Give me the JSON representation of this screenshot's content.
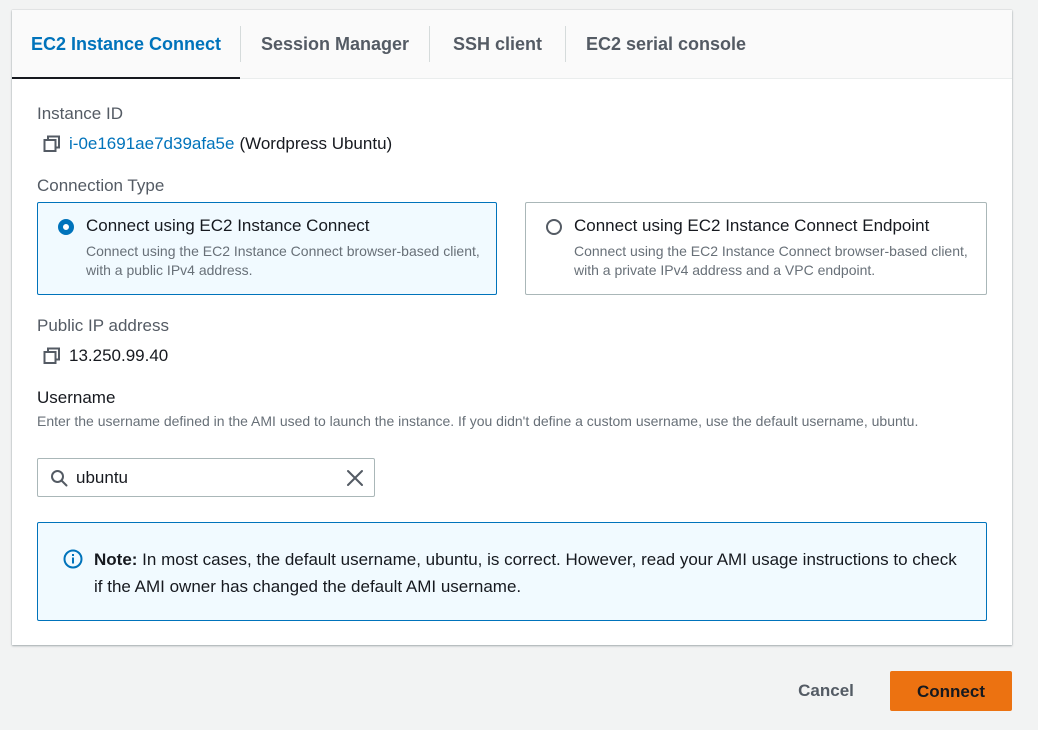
{
  "tabs": [
    {
      "label": "EC2 Instance Connect",
      "active": true
    },
    {
      "label": "Session Manager",
      "active": false
    },
    {
      "label": "SSH client",
      "active": false
    },
    {
      "label": "EC2 serial console",
      "active": false
    }
  ],
  "instance": {
    "label": "Instance ID",
    "id": "i-0e1691ae7d39afa5e",
    "name": "(Wordpress Ubuntu)"
  },
  "connection_type": {
    "label": "Connection Type",
    "options": [
      {
        "title": "Connect using EC2 Instance Connect",
        "description": "Connect using the EC2 Instance Connect browser-based client, with a public IPv4 address.",
        "selected": true
      },
      {
        "title": "Connect using EC2 Instance Connect Endpoint",
        "description": "Connect using the EC2 Instance Connect browser-based client, with a private IPv4 address and a VPC endpoint.",
        "selected": false
      }
    ]
  },
  "public_ip": {
    "label": "Public IP address",
    "value": "13.250.99.40"
  },
  "username": {
    "label": "Username",
    "description": "Enter the username defined in the AMI used to launch the instance. If you didn't define a custom username, use the default username, ubuntu.",
    "value": "ubuntu"
  },
  "note": {
    "prefix": "Note:",
    "text": " In most cases, the default username, ubuntu, is correct. However, read your AMI usage instructions to check if the AMI owner has changed the default AMI username."
  },
  "actions": {
    "cancel": "Cancel",
    "connect": "Connect"
  },
  "colors": {
    "accent": "#0073bb",
    "primary_button": "#ec7211",
    "selected_bg": "#f1faff"
  },
  "icons": {
    "copy": "copy-icon",
    "search": "search-icon",
    "clear": "close-icon",
    "info": "info-icon"
  }
}
